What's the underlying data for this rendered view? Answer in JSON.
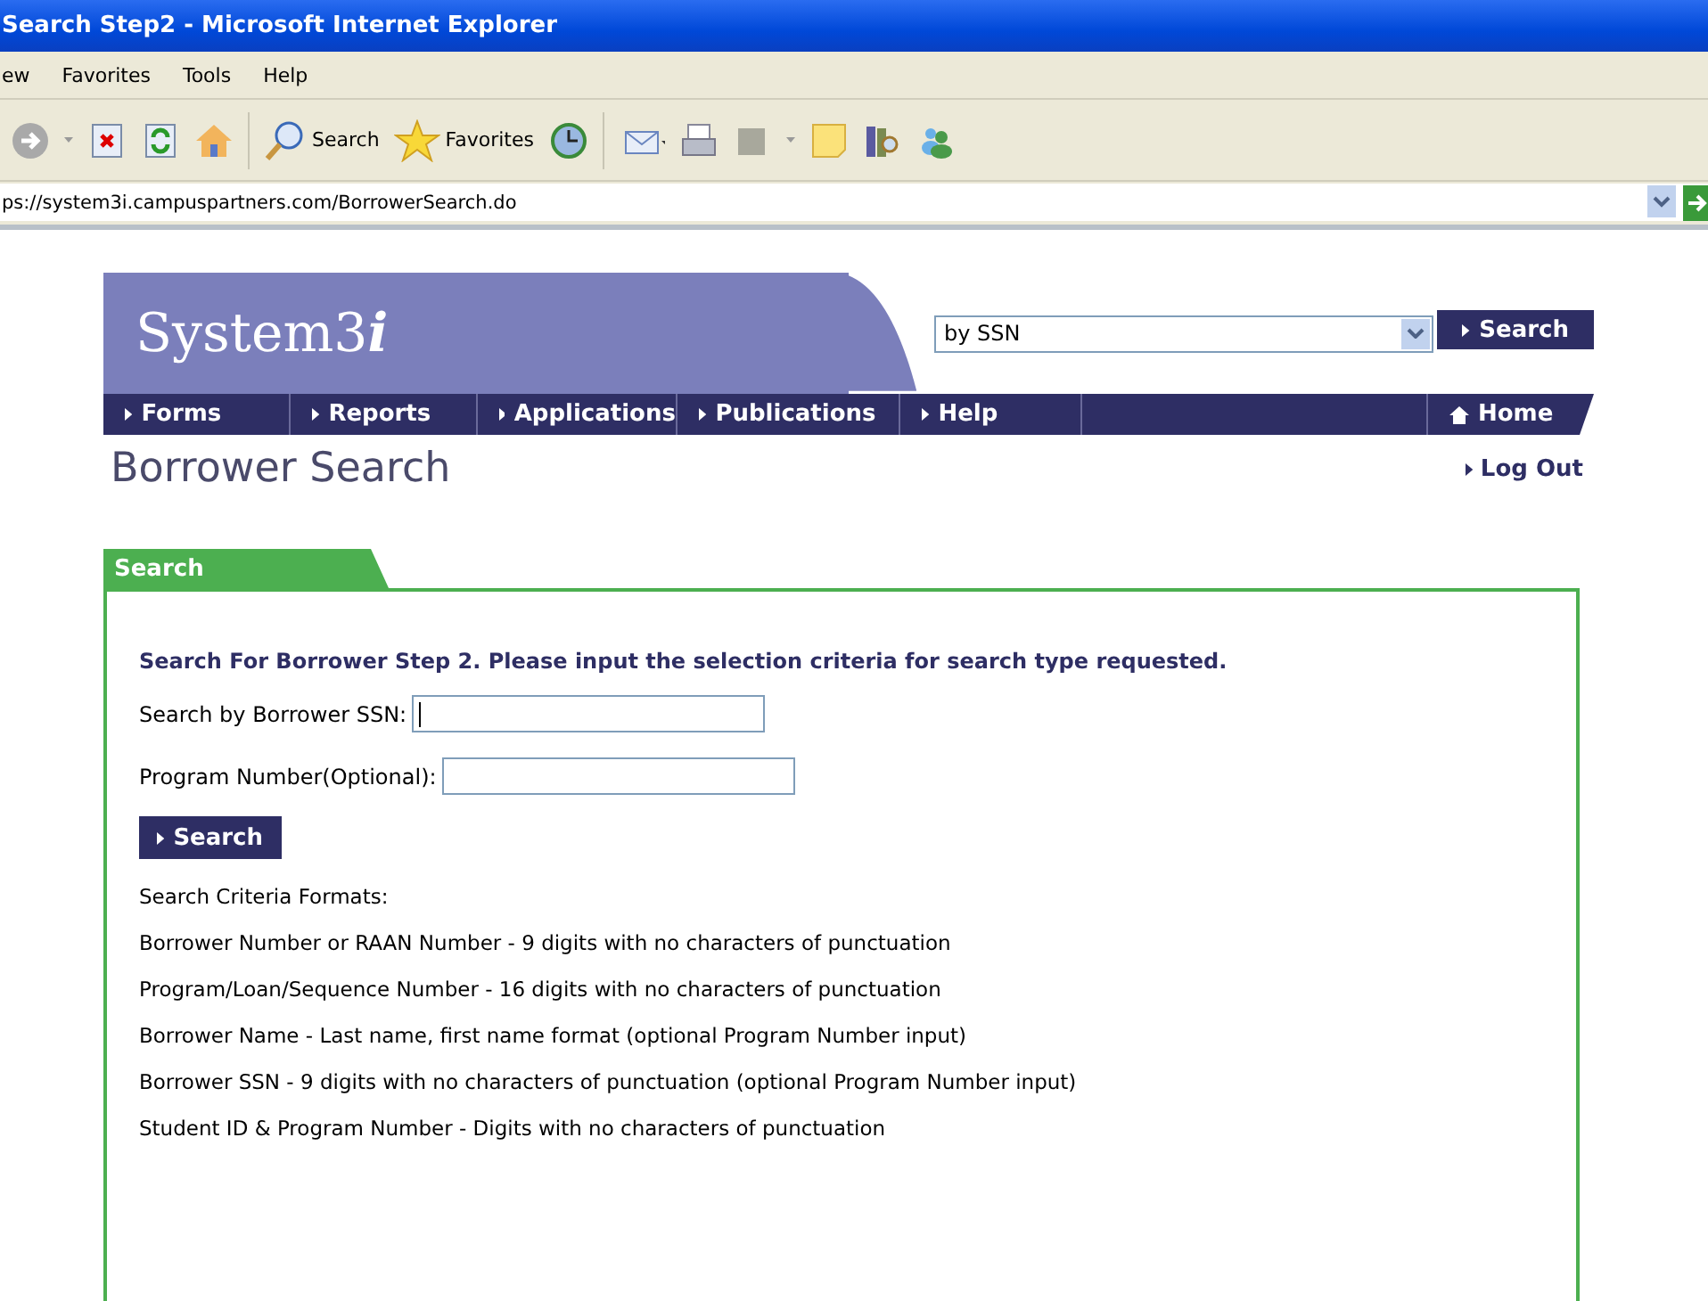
{
  "window": {
    "title": "Search Step2 - Microsoft Internet Explorer"
  },
  "menu_bar": [
    "ew",
    "Favorites",
    "Tools",
    "Help"
  ],
  "toolbar": {
    "search_label": "Search",
    "favorites_label": "Favorites"
  },
  "address_bar": {
    "value": "ps://system3i.campuspartners.com/BorrowerSearch.do"
  },
  "site": {
    "logo_text": "System3",
    "logo_suffix": "i",
    "search_select": {
      "value": "by SSN"
    },
    "search_button": "Search",
    "nav": [
      {
        "label": "Forms",
        "kind": "link"
      },
      {
        "label": "Reports",
        "kind": "link"
      },
      {
        "label": "Applications",
        "kind": "link"
      },
      {
        "label": "Publications",
        "kind": "link"
      },
      {
        "label": "Help",
        "kind": "link"
      },
      {
        "kind": "spacer"
      },
      {
        "label": "Home",
        "kind": "home"
      }
    ],
    "page_title": "Borrower Search",
    "logout": "Log Out"
  },
  "panel": {
    "tab": "Search",
    "heading": "Search For Borrower Step 2. Please input the selection criteria for search type requested.",
    "fields": [
      {
        "label": "Search by Borrower SSN:",
        "focused": true
      },
      {
        "label": "Program Number(Optional):",
        "focused": false
      }
    ],
    "button": "Search",
    "formats_title": "Search Criteria Formats:",
    "formats": [
      "Borrower Number or RAAN Number - 9 digits with no characters of punctuation",
      "Program/Loan/Sequence Number - 16 digits with no characters of punctuation",
      "Borrower Name - Last name, first name format (optional Program Number input)",
      "Borrower SSN - 9 digits with no characters of punctuation (optional Program Number input)",
      "Student ID & Program Number - Digits with no characters of punctuation"
    ]
  }
}
